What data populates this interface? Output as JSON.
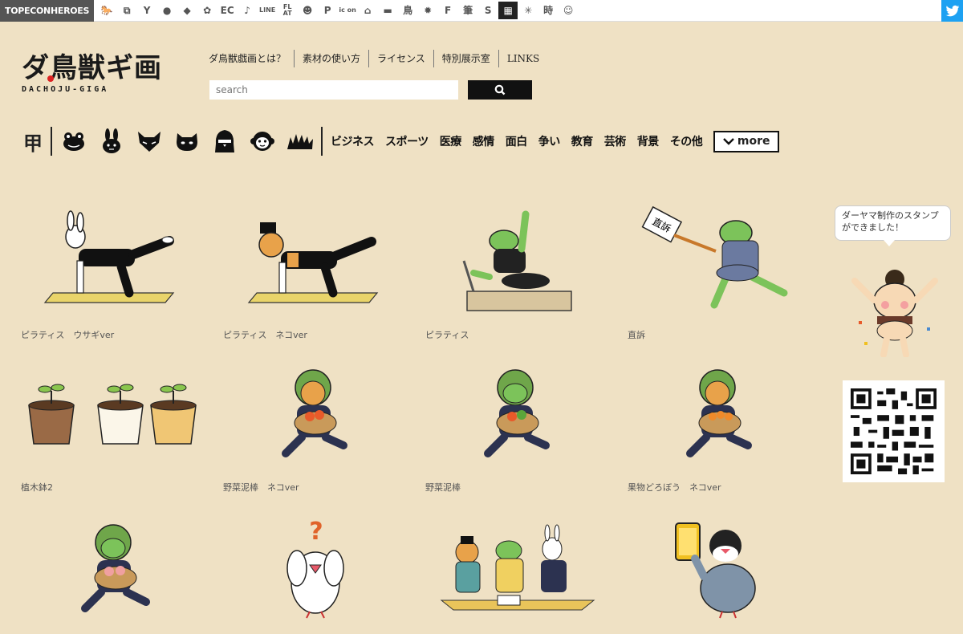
{
  "topbar": {
    "brand": "TOPECONHEROES",
    "icons": [
      {
        "name": "horse-icon",
        "glyph": "🐎"
      },
      {
        "name": "windows-icon",
        "glyph": "⧉"
      },
      {
        "name": "person-icon",
        "glyph": "Y"
      },
      {
        "name": "speech-bubble-icon",
        "glyph": "●"
      },
      {
        "name": "tag-icon",
        "glyph": "◆"
      },
      {
        "name": "flower-icon",
        "glyph": "✿"
      },
      {
        "name": "ec-icon",
        "glyph": "EC"
      },
      {
        "name": "music-note-icon",
        "glyph": "♪"
      },
      {
        "name": "line-icon",
        "glyph": "LINE"
      },
      {
        "name": "flat-icon",
        "glyph": "FL AT"
      },
      {
        "name": "smiley-icon",
        "glyph": "☻"
      },
      {
        "name": "p-icon",
        "glyph": "P"
      },
      {
        "name": "icon-text-icon",
        "glyph": "ic on"
      },
      {
        "name": "building-icon",
        "glyph": "⌂"
      },
      {
        "name": "bus-icon",
        "glyph": "▬"
      },
      {
        "name": "bird-kanji-icon",
        "glyph": "鳥"
      },
      {
        "name": "gear-icon",
        "glyph": "✹"
      },
      {
        "name": "f-icon",
        "glyph": "F"
      },
      {
        "name": "brush-kanji-icon",
        "glyph": "筆"
      },
      {
        "name": "s-icon",
        "glyph": "S"
      },
      {
        "name": "grid-icon",
        "glyph": "▦"
      },
      {
        "name": "sparkle-icon",
        "glyph": "✳"
      },
      {
        "name": "time-kanji-icon",
        "glyph": "時"
      },
      {
        "name": "face-icon",
        "glyph": "☺"
      }
    ]
  },
  "logo": {
    "jp": "ダ鳥獣ギ画",
    "en": "DACHOJU-GIGA"
  },
  "nav": [
    "ダ鳥獣戯画とは？",
    "素材の使い方",
    "ライセンス",
    "特別展示室",
    "LINKS"
  ],
  "search": {
    "placeholder": "search"
  },
  "categories": {
    "icons": [
      "kou-kanji-icon",
      "frog-icon",
      "rabbit-icon",
      "fox-icon",
      "cat-icon",
      "penguin-icon",
      "monkey-icon",
      "grass-icon"
    ],
    "kou_glyph": "甲",
    "labels": [
      "ビジネス",
      "スポーツ",
      "医療",
      "感情",
      "面白",
      "争い",
      "教育",
      "芸術",
      "背景",
      "その他"
    ],
    "more": "more"
  },
  "items": [
    {
      "caption": "ピラティス　ウサギver",
      "art": "rabbit-pilates"
    },
    {
      "caption": "ピラティス　ネコver",
      "art": "cat-pilates"
    },
    {
      "caption": "ピラティス",
      "art": "frog-pilates"
    },
    {
      "caption": "直訴",
      "art": "frog-petition"
    },
    {
      "caption": "植木鉢2",
      "art": "flowerpots"
    },
    {
      "caption": "野菜泥棒　ネコver",
      "art": "cat-thief"
    },
    {
      "caption": "野菜泥棒",
      "art": "frog-thief"
    },
    {
      "caption": "果物どろぼう　ネコver",
      "art": "cat-fruit-thief"
    },
    {
      "caption": "",
      "art": "frog-peach"
    },
    {
      "caption": "",
      "art": "bird-question"
    },
    {
      "caption": "",
      "art": "meeting"
    },
    {
      "caption": "",
      "art": "bird-phone"
    }
  ],
  "sidebar": {
    "bubble": "ダーヤマ制作のスタンプができました！",
    "petition_sign": "直訴"
  },
  "colors": {
    "background": "#efe1c4",
    "frog": "#7cc35a",
    "cat": "#e8a24a",
    "mat": "#e9d46a"
  }
}
